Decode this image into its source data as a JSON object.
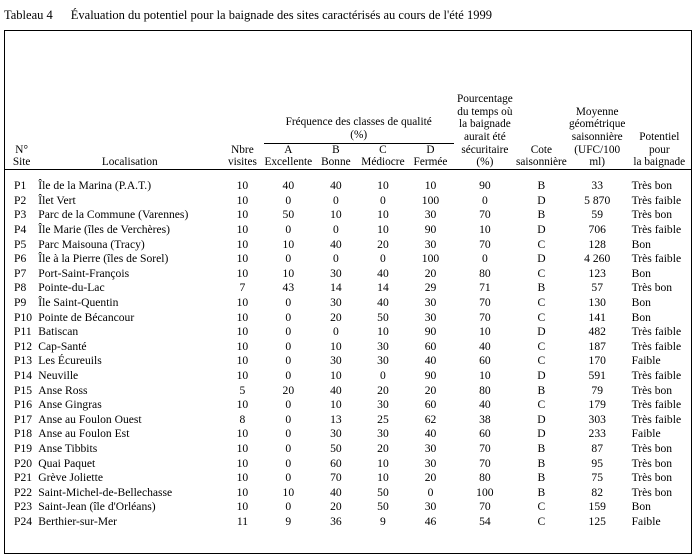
{
  "caption": {
    "label": "Tableau 4",
    "text": "Évaluation du potentiel pour la baignade des sites caractérisés au cours de l'été 1999"
  },
  "table": {
    "headers": {
      "site": [
        "N°",
        "Site"
      ],
      "localisation": "Localisation",
      "visites": [
        "Nbre",
        "visites"
      ],
      "frequence_group": [
        "Fréquence des classes de qualité",
        "(%)"
      ],
      "classe_a": [
        "A",
        "Excellente"
      ],
      "classe_b": [
        "B",
        "Bonne"
      ],
      "classe_c": [
        "C",
        "Médiocre"
      ],
      "classe_d": [
        "D",
        "Fermée"
      ],
      "pourcentage": [
        "Pourcentage",
        "du temps où",
        "la baignade",
        "aurait été",
        "sécuritaire",
        "(%)"
      ],
      "cote": [
        "Cote",
        "saisonnière"
      ],
      "moyenne": [
        "Moyenne",
        "géométrique",
        "saisonnière",
        "(UFC/100 ml)"
      ],
      "potentiel": [
        "Potentiel",
        "pour",
        "la baignade"
      ]
    },
    "rows": [
      {
        "site": "P1",
        "loc": "Île de la Marina (P.A.T.)",
        "vis": "10",
        "a": "40",
        "b": "40",
        "c": "10",
        "d": "10",
        "pct": "90",
        "cote": "B",
        "moy": "33",
        "pot": "Très bon"
      },
      {
        "site": "P2",
        "loc": "Îlet Vert",
        "vis": "10",
        "a": "0",
        "b": "0",
        "c": "0",
        "d": "100",
        "pct": "0",
        "cote": "D",
        "moy": "5 870",
        "pot": "Très faible"
      },
      {
        "site": "P3",
        "loc": "Parc de la Commune (Varennes)",
        "vis": "10",
        "a": "50",
        "b": "10",
        "c": "10",
        "d": "30",
        "pct": "70",
        "cote": "B",
        "moy": "59",
        "pot": "Très bon"
      },
      {
        "site": "P4",
        "loc": "Île Marie (îles de Verchères)",
        "vis": "10",
        "a": "0",
        "b": "0",
        "c": "10",
        "d": "90",
        "pct": "10",
        "cote": "D",
        "moy": "706",
        "pot": "Très faible"
      },
      {
        "site": "P5",
        "loc": "Parc Maisouna (Tracy)",
        "vis": "10",
        "a": "10",
        "b": "40",
        "c": "20",
        "d": "30",
        "pct": "70",
        "cote": "C",
        "moy": "128",
        "pot": "Bon"
      },
      {
        "site": "P6",
        "loc": "Île à la Pierre (îles de Sorel)",
        "vis": "10",
        "a": "0",
        "b": "0",
        "c": "0",
        "d": "100",
        "pct": "0",
        "cote": "D",
        "moy": "4 260",
        "pot": "Très faible"
      },
      {
        "site": "P7",
        "loc": "Port-Saint-François",
        "vis": "10",
        "a": "10",
        "b": "30",
        "c": "40",
        "d": "20",
        "pct": "80",
        "cote": "C",
        "moy": "123",
        "pot": "Bon"
      },
      {
        "site": "P8",
        "loc": "Pointe-du-Lac",
        "vis": "7",
        "a": "43",
        "b": "14",
        "c": "14",
        "d": "29",
        "pct": "71",
        "cote": "B",
        "moy": "57",
        "pot": "Très bon"
      },
      {
        "site": "P9",
        "loc": "Île Saint-Quentin",
        "vis": "10",
        "a": "0",
        "b": "30",
        "c": "40",
        "d": "30",
        "pct": "70",
        "cote": "C",
        "moy": "130",
        "pot": "Bon"
      },
      {
        "site": "P10",
        "loc": "Pointe de Bécancour",
        "vis": "10",
        "a": "0",
        "b": "20",
        "c": "50",
        "d": "30",
        "pct": "70",
        "cote": "C",
        "moy": "141",
        "pot": "Bon"
      },
      {
        "site": "P11",
        "loc": "Batiscan",
        "vis": "10",
        "a": "0",
        "b": "0",
        "c": "10",
        "d": "90",
        "pct": "10",
        "cote": "D",
        "moy": "482",
        "pot": "Très faible"
      },
      {
        "site": "P12",
        "loc": "Cap-Santé",
        "vis": "10",
        "a": "0",
        "b": "10",
        "c": "30",
        "d": "60",
        "pct": "40",
        "cote": "C",
        "moy": "187",
        "pot": "Très faible"
      },
      {
        "site": "P13",
        "loc": "Les Écureuils",
        "vis": "10",
        "a": "0",
        "b": "30",
        "c": "30",
        "d": "40",
        "pct": "60",
        "cote": "C",
        "moy": "170",
        "pot": "Faible"
      },
      {
        "site": "P14",
        "loc": "Neuville",
        "vis": "10",
        "a": "0",
        "b": "10",
        "c": "0",
        "d": "90",
        "pct": "10",
        "cote": "D",
        "moy": "591",
        "pot": "Très faible"
      },
      {
        "site": "P15",
        "loc": "Anse Ross",
        "vis": "5",
        "a": "20",
        "b": "40",
        "c": "20",
        "d": "20",
        "pct": "80",
        "cote": "B",
        "moy": "79",
        "pot": "Très bon"
      },
      {
        "site": "P16",
        "loc": "Anse Gingras",
        "vis": "10",
        "a": "0",
        "b": "10",
        "c": "30",
        "d": "60",
        "pct": "40",
        "cote": "C",
        "moy": "179",
        "pot": "Très faible"
      },
      {
        "site": "P17",
        "loc": "Anse au Foulon Ouest",
        "vis": "8",
        "a": "0",
        "b": "13",
        "c": "25",
        "d": "62",
        "pct": "38",
        "cote": "D",
        "moy": "303",
        "pot": "Très faible"
      },
      {
        "site": "P18",
        "loc": "Anse au Foulon Est",
        "vis": "10",
        "a": "0",
        "b": "30",
        "c": "30",
        "d": "40",
        "pct": "60",
        "cote": "D",
        "moy": "233",
        "pot": "Faible"
      },
      {
        "site": "P19",
        "loc": "Anse Tibbits",
        "vis": "10",
        "a": "0",
        "b": "50",
        "c": "20",
        "d": "30",
        "pct": "70",
        "cote": "B",
        "moy": "87",
        "pot": "Très bon"
      },
      {
        "site": "P20",
        "loc": "Quai Paquet",
        "vis": "10",
        "a": "0",
        "b": "60",
        "c": "10",
        "d": "30",
        "pct": "70",
        "cote": "B",
        "moy": "95",
        "pot": "Très bon"
      },
      {
        "site": "P21",
        "loc": "Grève Joliette",
        "vis": "10",
        "a": "0",
        "b": "70",
        "c": "10",
        "d": "20",
        "pct": "80",
        "cote": "B",
        "moy": "75",
        "pot": "Très bon"
      },
      {
        "site": "P22",
        "loc": "Saint-Michel-de-Bellechasse",
        "vis": "10",
        "a": "10",
        "b": "40",
        "c": "50",
        "d": "0",
        "pct": "100",
        "cote": "B",
        "moy": "82",
        "pot": "Très bon"
      },
      {
        "site": "P23",
        "loc": "Saint-Jean (île d'Orléans)",
        "vis": "10",
        "a": "0",
        "b": "20",
        "c": "50",
        "d": "30",
        "pct": "70",
        "cote": "C",
        "moy": "159",
        "pot": "Bon"
      },
      {
        "site": "P24",
        "loc": "Berthier-sur-Mer",
        "vis": "11",
        "a": "9",
        "b": "36",
        "c": "9",
        "d": "46",
        "pct": "54",
        "cote": "C",
        "moy": "125",
        "pot": "Faible"
      }
    ]
  }
}
